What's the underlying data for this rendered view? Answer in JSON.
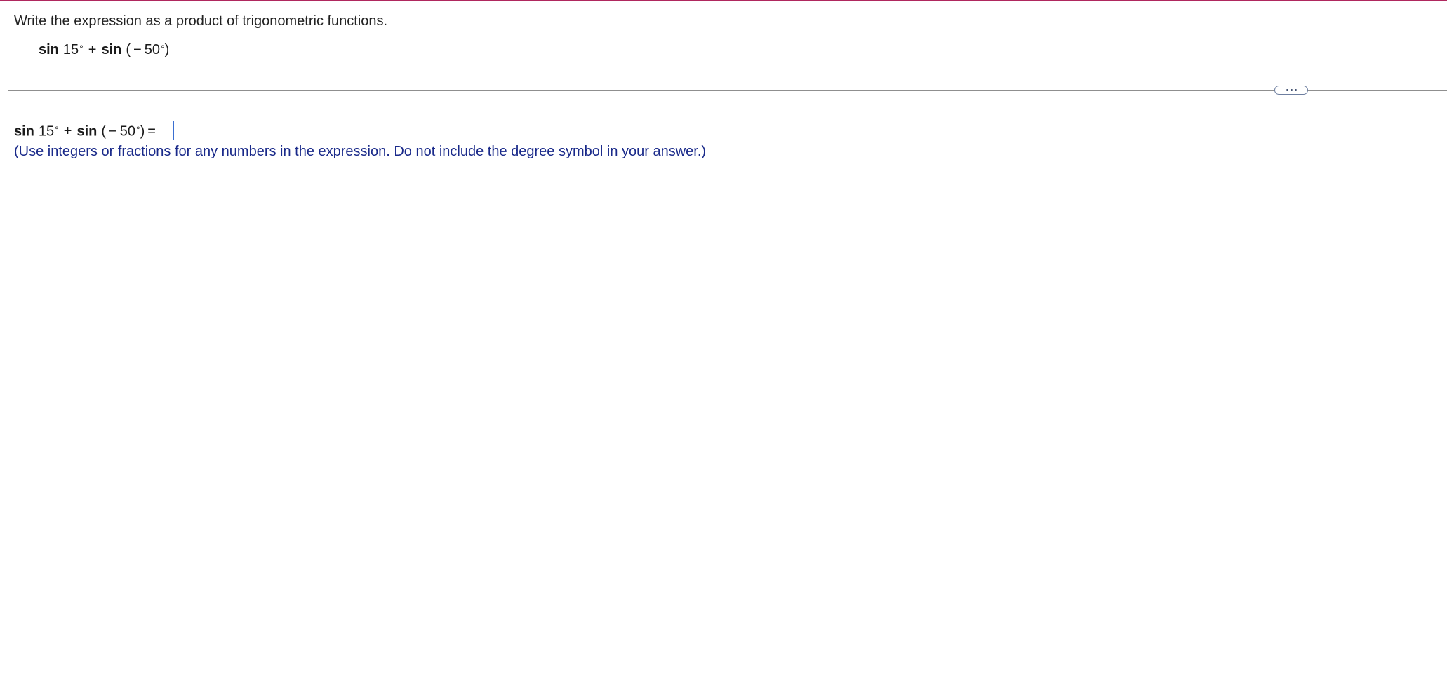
{
  "question": {
    "instruction": "Write the expression as a product of trigonometric functions.",
    "given_expression": {
      "term1_fn": "sin",
      "term1_arg": "15",
      "degree": "°",
      "operator": "+",
      "term2_fn": "sin",
      "term2_open": "(",
      "term2_neg": "−",
      "term2_arg": "50",
      "term2_close": ")"
    }
  },
  "toolbar": {
    "more_icon": "ellipsis-icon"
  },
  "answer": {
    "equals": "=",
    "input_value": "",
    "hint": "(Use integers or fractions for any numbers in the expression. Do not include the degree symbol in your answer.)"
  },
  "colors": {
    "top_rule": "#b0285e",
    "hint_text": "#1a2a8a",
    "input_border": "#3a6fd1"
  }
}
